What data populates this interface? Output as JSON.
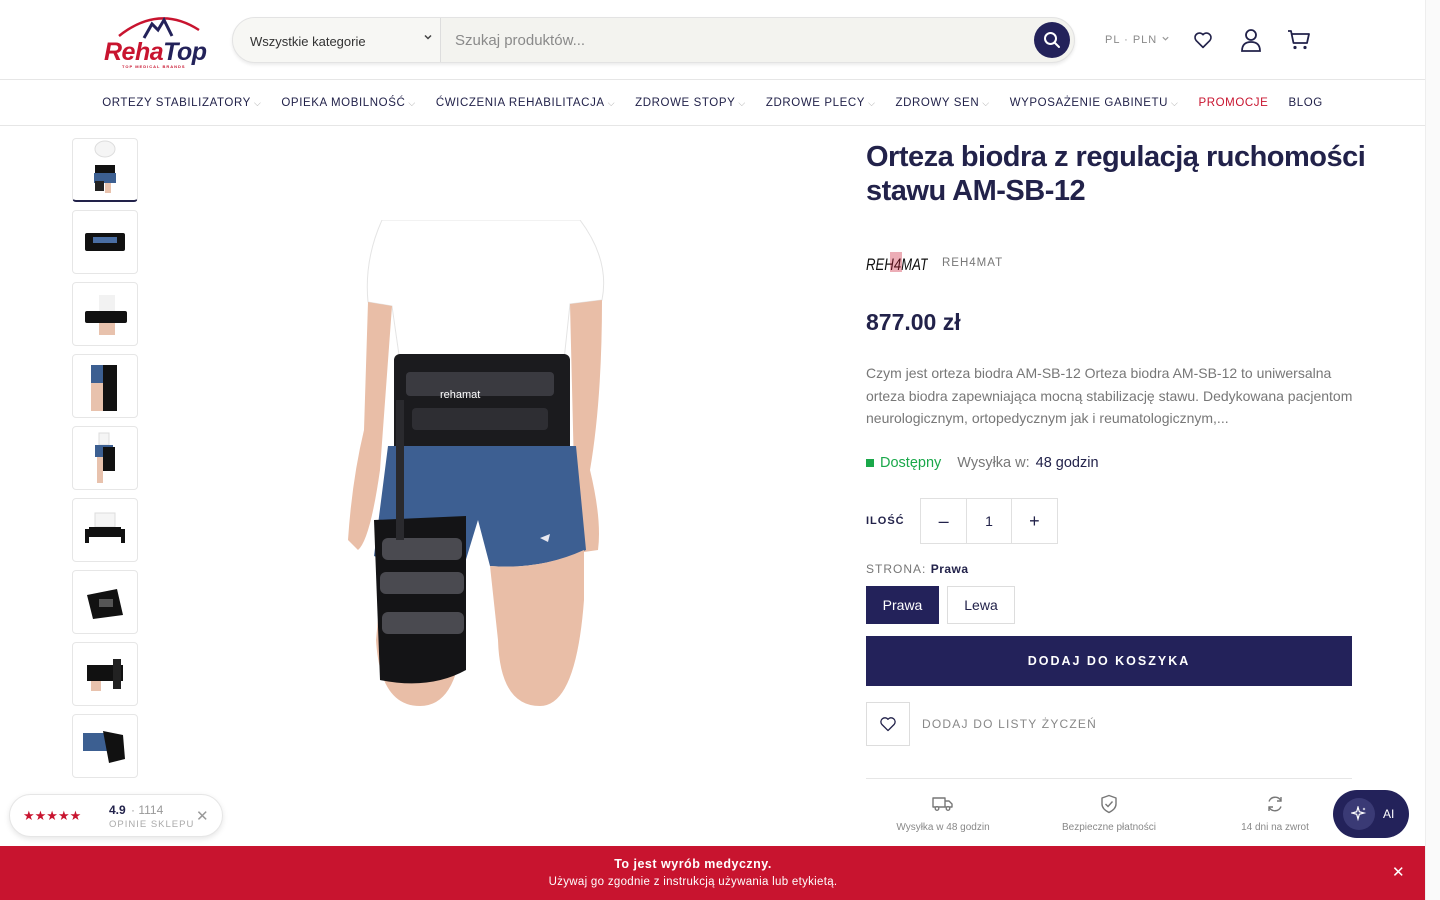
{
  "header": {
    "logo_text_a": "Reha",
    "logo_text_b": "Top",
    "logo_tagline": "TOP MEDICAL BRANDS",
    "search": {
      "category_label": "Wszystkie kategorie",
      "placeholder": "Szukaj produktów..."
    },
    "lang_currency": "PL · PLN",
    "icons": [
      "heart-icon",
      "user-icon",
      "cart-icon"
    ]
  },
  "nav": {
    "items": [
      {
        "label": "ORTEZY STABILIZATORY"
      },
      {
        "label": "OPIEKA MOBILNOŚĆ"
      },
      {
        "label": "ĆWICZENIA REHABILITACJA"
      },
      {
        "label": "ZDROWE STOPY"
      },
      {
        "label": "ZDROWE PLECY"
      },
      {
        "label": "ZDROWY SEN"
      },
      {
        "label": "WYPOSAŻENIE GABINETU"
      },
      {
        "label": "PROMOCJE"
      },
      {
        "label": "BLOG"
      }
    ]
  },
  "product": {
    "title": "Orteza biodra z regulacją ruchomości stawu AM-SB-12",
    "brand_logo_text": "REH4MAT",
    "brand": "REH4MAT",
    "price": "877.00 zł",
    "description": "Czym jest orteza biodra AM-SB-12 Orteza biodra AM-SB-12 to uniwersalna orteza biodra zapewniająca mocną stabilizację stawu. Dedykowana pacjentom neurologicznym, ortopedycznym jak i reumatologicznym,...",
    "availability": "Dostępny",
    "shipping_label": "Wysyłka w:",
    "shipping_time": "48 godzin",
    "quantity_label": "ILOŚĆ",
    "quantity": "1",
    "qty_minus": "–",
    "qty_plus": "+",
    "side_label": "STRONA:",
    "side_selected": "Prawa",
    "side_options": [
      "Prawa",
      "Lewa"
    ],
    "add_to_cart": "DODAJ DO KOSZYKA",
    "add_to_wishlist": "DODAJ DO LISTY ŻYCZEŃ",
    "main_image_brand": "rehamat",
    "features": [
      {
        "icon": "truck-icon",
        "label": "Wysyłka w 48 godzin"
      },
      {
        "icon": "shield-check-icon",
        "label": "Bezpieczne płatności"
      },
      {
        "icon": "refresh-icon",
        "label": "14 dni na zwrot"
      }
    ]
  },
  "rating_widget": {
    "stars": "★★★★★",
    "score": "4.9",
    "count": "· 1114",
    "subtitle": "OPINIE SKLEPU",
    "close": "✕"
  },
  "ai_button": {
    "label": "AI"
  },
  "banner": {
    "title": "To jest wyrób medyczny.",
    "text": "Używaj go zgodnie z instrukcją używania lub etykietą.",
    "close": "✕"
  },
  "colors": {
    "brand_navy": "#23225a",
    "brand_red": "#c8142f",
    "available_green": "#1aa84a"
  }
}
